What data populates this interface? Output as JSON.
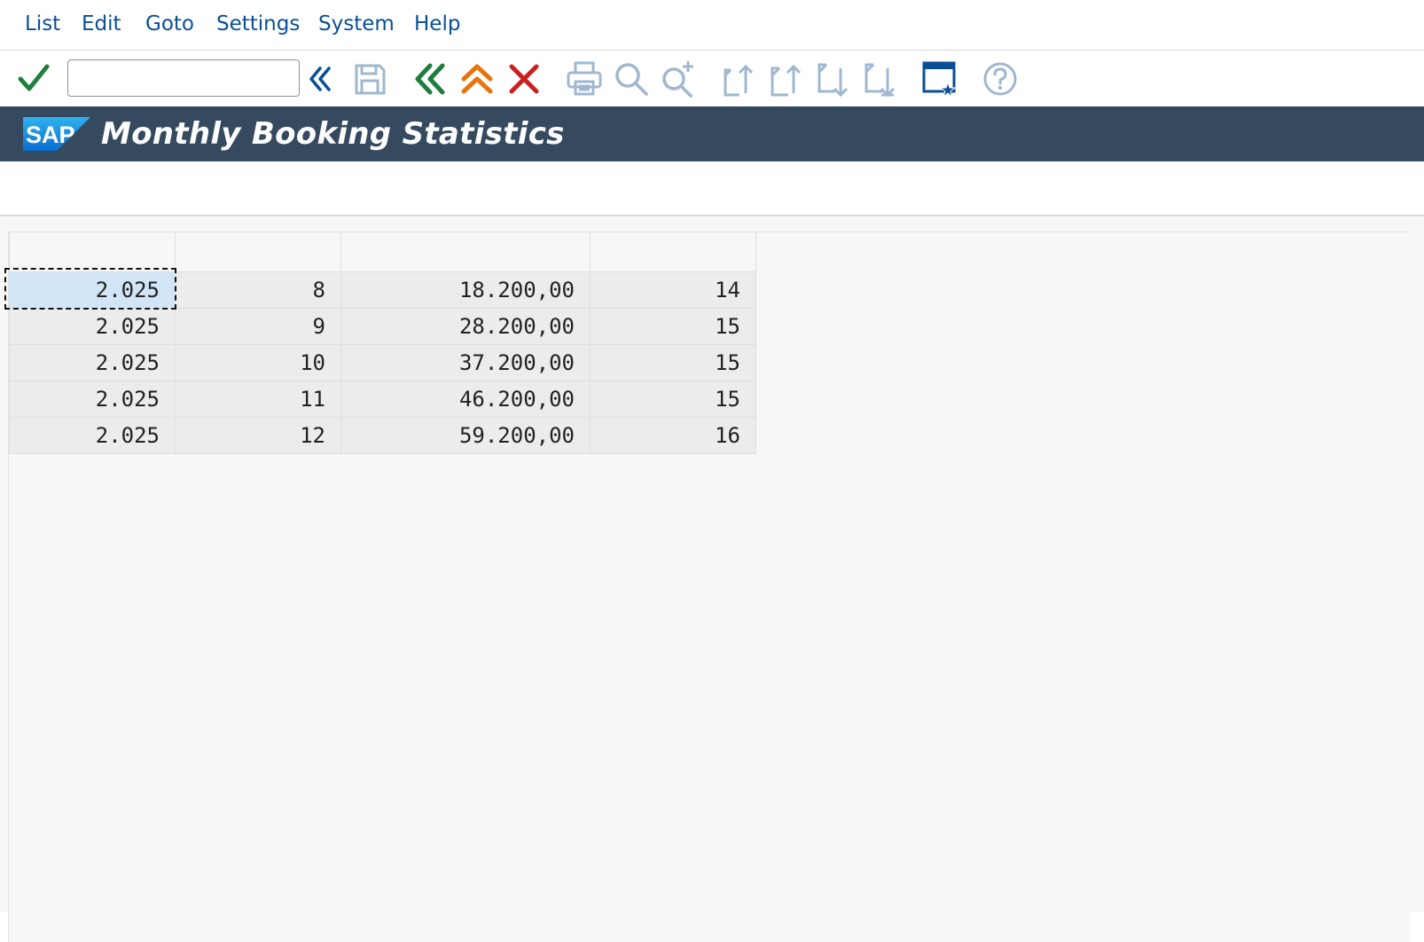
{
  "menu": {
    "items": [
      "List",
      "Edit",
      "Goto",
      "Settings",
      "System",
      "Help"
    ]
  },
  "toolbar": {
    "command_field": {
      "value": "",
      "placeholder": ""
    },
    "icons": [
      "checkmark-icon",
      "expand-history-icon",
      "save-icon",
      "back-icon",
      "exit-icon",
      "cancel-icon",
      "print-icon",
      "find-icon",
      "find-next-icon",
      "first-page-icon",
      "previous-page-icon",
      "next-page-icon",
      "last-page-icon",
      "customize-layout-icon",
      "help-icon"
    ],
    "colors": {
      "check": "#1e7e3e",
      "back": "#1e7e3e",
      "exit": "#e8740c",
      "cancel": "#cc1f1f",
      "disabled": "#9fb8cf",
      "active": "#0a4f96"
    }
  },
  "titlebar": {
    "logo_text": "SAP",
    "title": "Monthly Booking Statistics",
    "background": "#354a5f"
  },
  "table": {
    "headers": [
      "",
      "",
      "",
      ""
    ],
    "rows": [
      [
        "2.025",
        "8",
        "18.200,00",
        "14"
      ],
      [
        "2.025",
        "9",
        "28.200,00",
        "15"
      ],
      [
        "2.025",
        "10",
        "37.200,00",
        "15"
      ],
      [
        "2.025",
        "11",
        "46.200,00",
        "15"
      ],
      [
        "2.025",
        "12",
        "59.200,00",
        "16"
      ]
    ],
    "selected_cell": {
      "row": 0,
      "col": 0
    },
    "selection_color": "#d1e5f7"
  }
}
